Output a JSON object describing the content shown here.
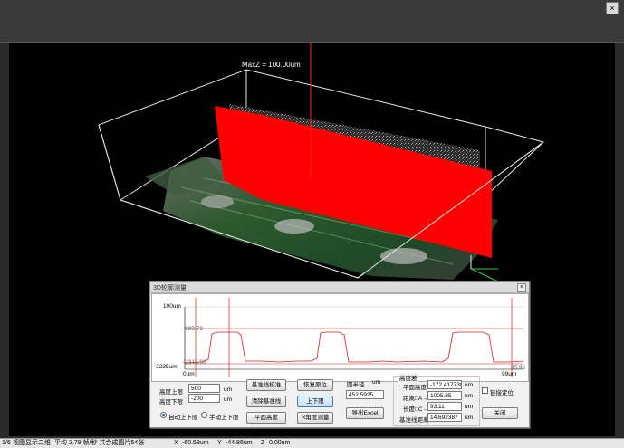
{
  "window": {
    "close_glyph": "×"
  },
  "viewport": {
    "maxz_label": "MaxZ = 100.00um"
  },
  "dialog": {
    "title": "3D轮廓测量",
    "close_glyph": "×",
    "plot": {
      "y_top": "100um",
      "y_bottom": "-2235um",
      "y_mid": "-989.73",
      "y_mid2": "-2315.91",
      "x_left": "0um",
      "x_right": "99um",
      "x_right2": "95.96"
    },
    "limits": {
      "upper_label": "高度上限",
      "upper_value": "500",
      "upper_unit": "um",
      "lower_label": "高度下限",
      "lower_value": "-200",
      "lower_unit": "um",
      "auto_label": "自动上下限",
      "manual_label": "手动上下限"
    },
    "buttons": {
      "baseline_calibrate": "基准线校准",
      "clear_baseline": "清除基准线",
      "plane_height": "平面高度",
      "restore_pos": "恢复原位",
      "up_down_limit": "上下限",
      "r_angle_measure": "R角度测量",
      "export_excel": "导出Excel",
      "close": "关闭"
    },
    "radius": {
      "label": "圆半径",
      "unit": "um",
      "value": "452.5925"
    },
    "height_diff": {
      "title": "高度差",
      "plane_label": "平面高度",
      "plane_value": "-172.417738",
      "plane_unit": "um",
      "ab_label": "距离□A→B",
      "ab_value": "1005.85",
      "ab_unit": "um",
      "cd_label": "长度□C→D",
      "cd_value": "93.11",
      "cd_unit": "um",
      "baseline_label": "基准线距离",
      "baseline_value": "14.692387",
      "baseline_unit": "um"
    },
    "link_label": "链接定位"
  },
  "status": {
    "s1": "1/6",
    "s2": "视图显示二维",
    "s3": "平均 2.79 帧/秒 共合成图片54张",
    "x_label": "X",
    "x_value": "-60.58um",
    "y_label": "Y",
    "y_value": "-44.86um",
    "z_label": "Z",
    "z_value": "0.00um"
  },
  "colors": {
    "profile": "#d32020",
    "plane": "#ff0000",
    "accent": "#3c7fb1"
  }
}
